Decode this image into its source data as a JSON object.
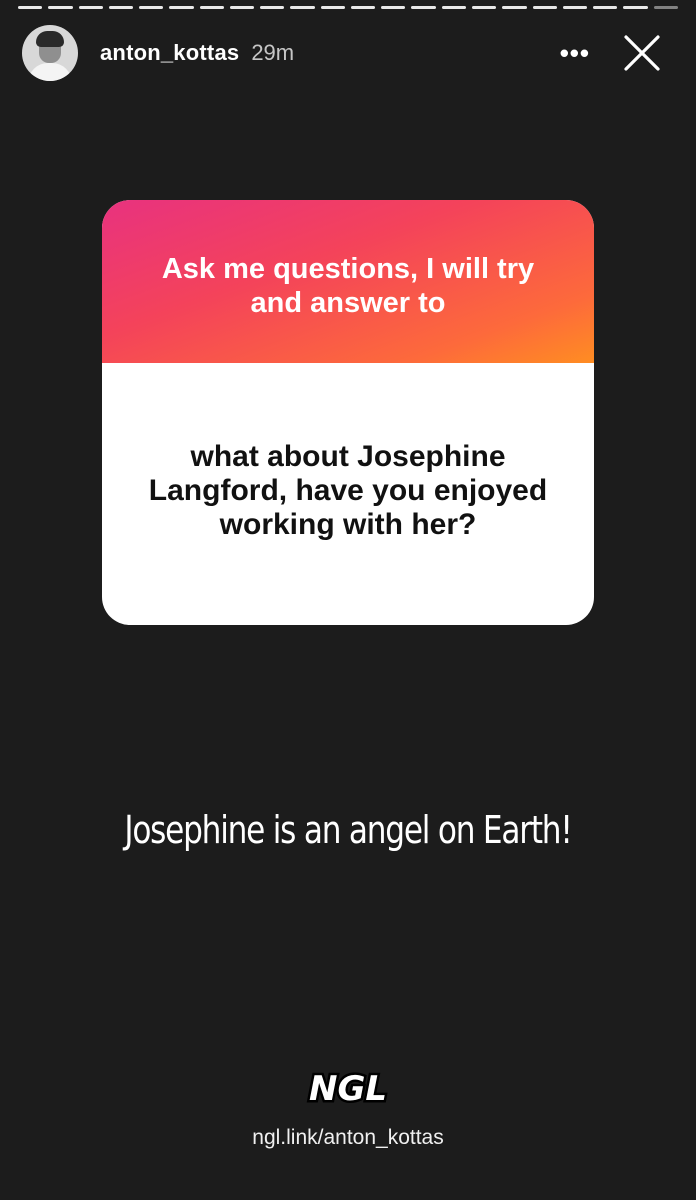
{
  "story": {
    "username": "anton_kottas",
    "time_ago": "29m",
    "segments_total": 22,
    "segments_viewed": 21
  },
  "header": {
    "more_icon": "more-horizontal-icon",
    "close_icon": "close-icon"
  },
  "question_card": {
    "prompt": "Ask me questions, I will try and answer to",
    "question": "what about Josephine Langford, have you enjoyed working with her?",
    "gradient_colors": [
      "#e8327f",
      "#f4435a",
      "#fd6a3b",
      "#ff8d22"
    ]
  },
  "answer_text": "Josephine is an angel on Earth!",
  "ngl": {
    "logo_text": "NGL",
    "link": "ngl.link/anton_kottas"
  },
  "colors": {
    "background": "#1c1c1c",
    "card_white": "#ffffff",
    "question_text": "#111111"
  }
}
